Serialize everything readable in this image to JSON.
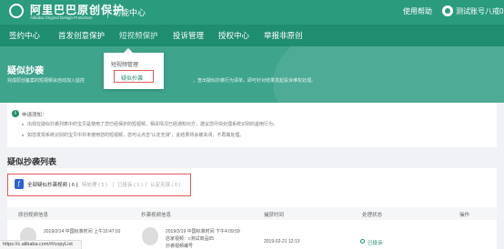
{
  "header": {
    "logo_text": "阿里巴巴原创保护",
    "logo_sub": "Alibaba Original Design Protection",
    "function_center": "功能中心",
    "help": "使用帮助",
    "account": "测试账号八戒02"
  },
  "nav": {
    "items": [
      "签约中心",
      "首发创意保护",
      "短视频保护",
      "投诉管理",
      "授权中心",
      "举报非原创"
    ]
  },
  "dropdown": {
    "items": [
      "短视频管理",
      "疑似抄袭"
    ]
  },
  "banner": {
    "title": "疑似抄袭",
    "desc_left": "完成原创备案的短视频会自动加入监控",
    "desc_right": "，查出疑似抄袭行为清单，即可针对结果发起投诉维权处理。"
  },
  "notice": {
    "title": "申请须知：",
    "line1": "出现在疑似抄袭列表中的宝贝是使用了您已经保护的短视频，相关情况已经通知对方，建议您尽快处理系统识别的盗用行为。",
    "line2": "如您发现系统识别的宝贝中并未使用您的短视频，您可以点击“认定无误”，此结果将会被关闭，不再做处理。"
  },
  "list": {
    "title": "疑似抄袭列表",
    "tabs": [
      {
        "label": "全部疑似抄袭视频 ( 6 )"
      },
      {
        "label": "待处理 ( 5 )"
      },
      {
        "label": "已投诉 ( 1 )"
      },
      {
        "label": "认定无误 ( 0 )"
      }
    ],
    "columns": [
      "原创视频信息",
      "抄袭视频信息",
      "捕获时间",
      "处理状态",
      "操作"
    ],
    "row": {
      "orig_date": "2019/2/14 中国标准时间 上午10:47:02",
      "copy_date": "2019/2/19 中国标准时间 下午4:09:59",
      "copy_store": "店家视频：c测试商品05",
      "copy_ref": "抄袭视频编号",
      "capture_time": "2019-02-21 12:13",
      "status": "已投诉"
    }
  },
  "url": "https://c.alibaba.com/#/copyList"
}
